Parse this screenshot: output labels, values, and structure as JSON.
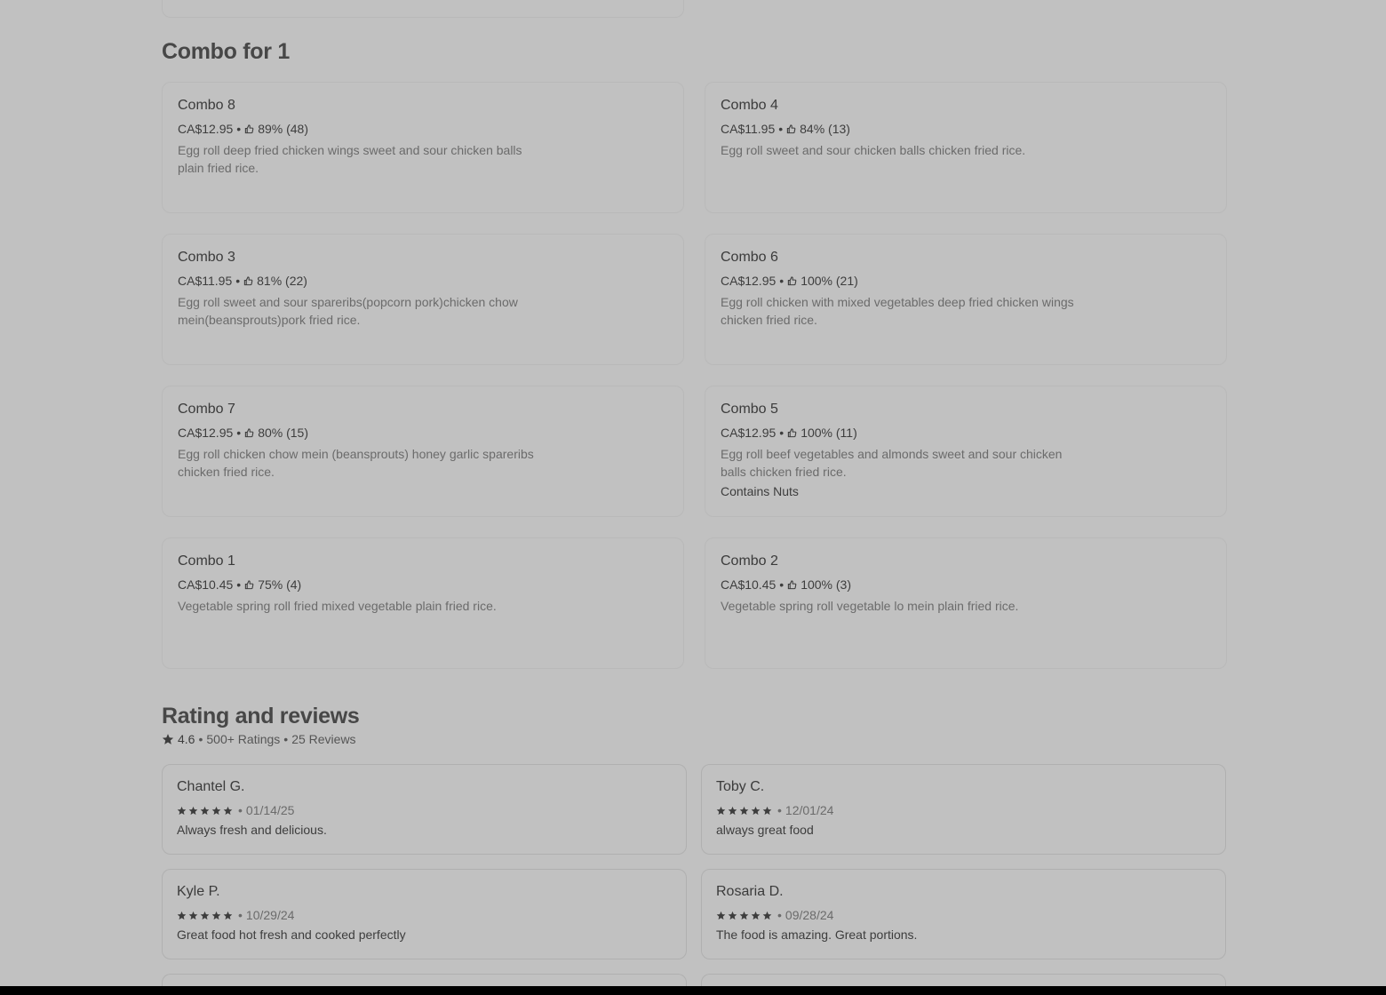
{
  "combo_section": {
    "title": "Combo for 1",
    "items": [
      {
        "name": "Combo 8",
        "price": "CA$12.95",
        "rating": "89% (48)",
        "description": "Egg roll deep fried chicken wings sweet and sour chicken balls plain fried rice.",
        "tag": ""
      },
      {
        "name": "Combo 4",
        "price": "CA$11.95",
        "rating": "84% (13)",
        "description": "Egg roll sweet and sour chicken balls chicken fried rice.",
        "tag": ""
      },
      {
        "name": "Combo 3",
        "price": "CA$11.95",
        "rating": "81% (22)",
        "description": "Egg roll sweet and sour spareribs(popcorn pork)chicken chow mein(beansprouts)pork fried rice.",
        "tag": ""
      },
      {
        "name": "Combo 6",
        "price": "CA$12.95",
        "rating": "100% (21)",
        "description": "Egg roll chicken with mixed vegetables deep fried chicken wings chicken fried rice.",
        "tag": ""
      },
      {
        "name": "Combo 7",
        "price": "CA$12.95",
        "rating": "80% (15)",
        "description": "Egg roll chicken chow mein (beansprouts) honey garlic spareribs chicken fried rice.",
        "tag": ""
      },
      {
        "name": "Combo 5",
        "price": "CA$12.95",
        "rating": "100% (11)",
        "description": "Egg roll beef vegetables and almonds sweet and sour chicken balls chicken fried rice.",
        "tag": "Contains Nuts"
      },
      {
        "name": "Combo 1",
        "price": "CA$10.45",
        "rating": "75% (4)",
        "description": "Vegetable spring roll fried mixed vegetable plain fried rice.",
        "tag": ""
      },
      {
        "name": "Combo 2",
        "price": "CA$10.45",
        "rating": "100% (3)",
        "description": "Vegetable spring roll vegetable lo mein plain fried rice.",
        "tag": ""
      }
    ]
  },
  "reviews_section": {
    "title": "Rating and reviews",
    "score": "4.6",
    "ratings_count": "500+ Ratings",
    "reviews_count": "25 Reviews",
    "reviews": [
      {
        "author": "Chantel G.",
        "date": "01/14/25",
        "text": "Always fresh and delicious.",
        "stars": 5
      },
      {
        "author": "Toby C.",
        "date": "12/01/24",
        "text": "always great food",
        "stars": 5
      },
      {
        "author": "Kyle P.",
        "date": "10/29/24",
        "text": "Great food hot fresh and cooked perfectly",
        "stars": 5
      },
      {
        "author": "Rosaria D.",
        "date": "09/28/24",
        "text": "The food is amazing. Great portions.",
        "stars": 5
      }
    ]
  },
  "icons": {
    "rating": "thumbs-up-icon",
    "star": "star-icon"
  },
  "colors": {
    "overlay_bg": "#c1c1c1",
    "text": "#3d3d3d"
  }
}
